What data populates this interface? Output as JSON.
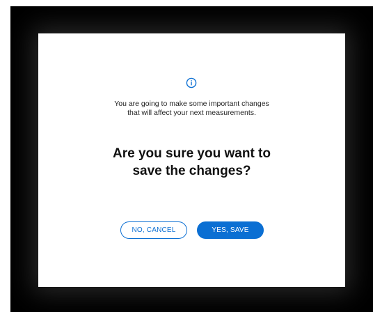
{
  "dialog": {
    "icon": "info-icon",
    "message_line1": "You are going to make some important changes",
    "message_line2": "that will affect your next measurements.",
    "question_line1": "Are you sure you want to",
    "question_line2": "save the changes?",
    "cancel_label": "NO, CANCEL",
    "save_label": "YES, SAVE"
  },
  "colors": {
    "accent": "#0b6fd3",
    "overlay": "#000000",
    "dialog_background": "#ffffff"
  }
}
